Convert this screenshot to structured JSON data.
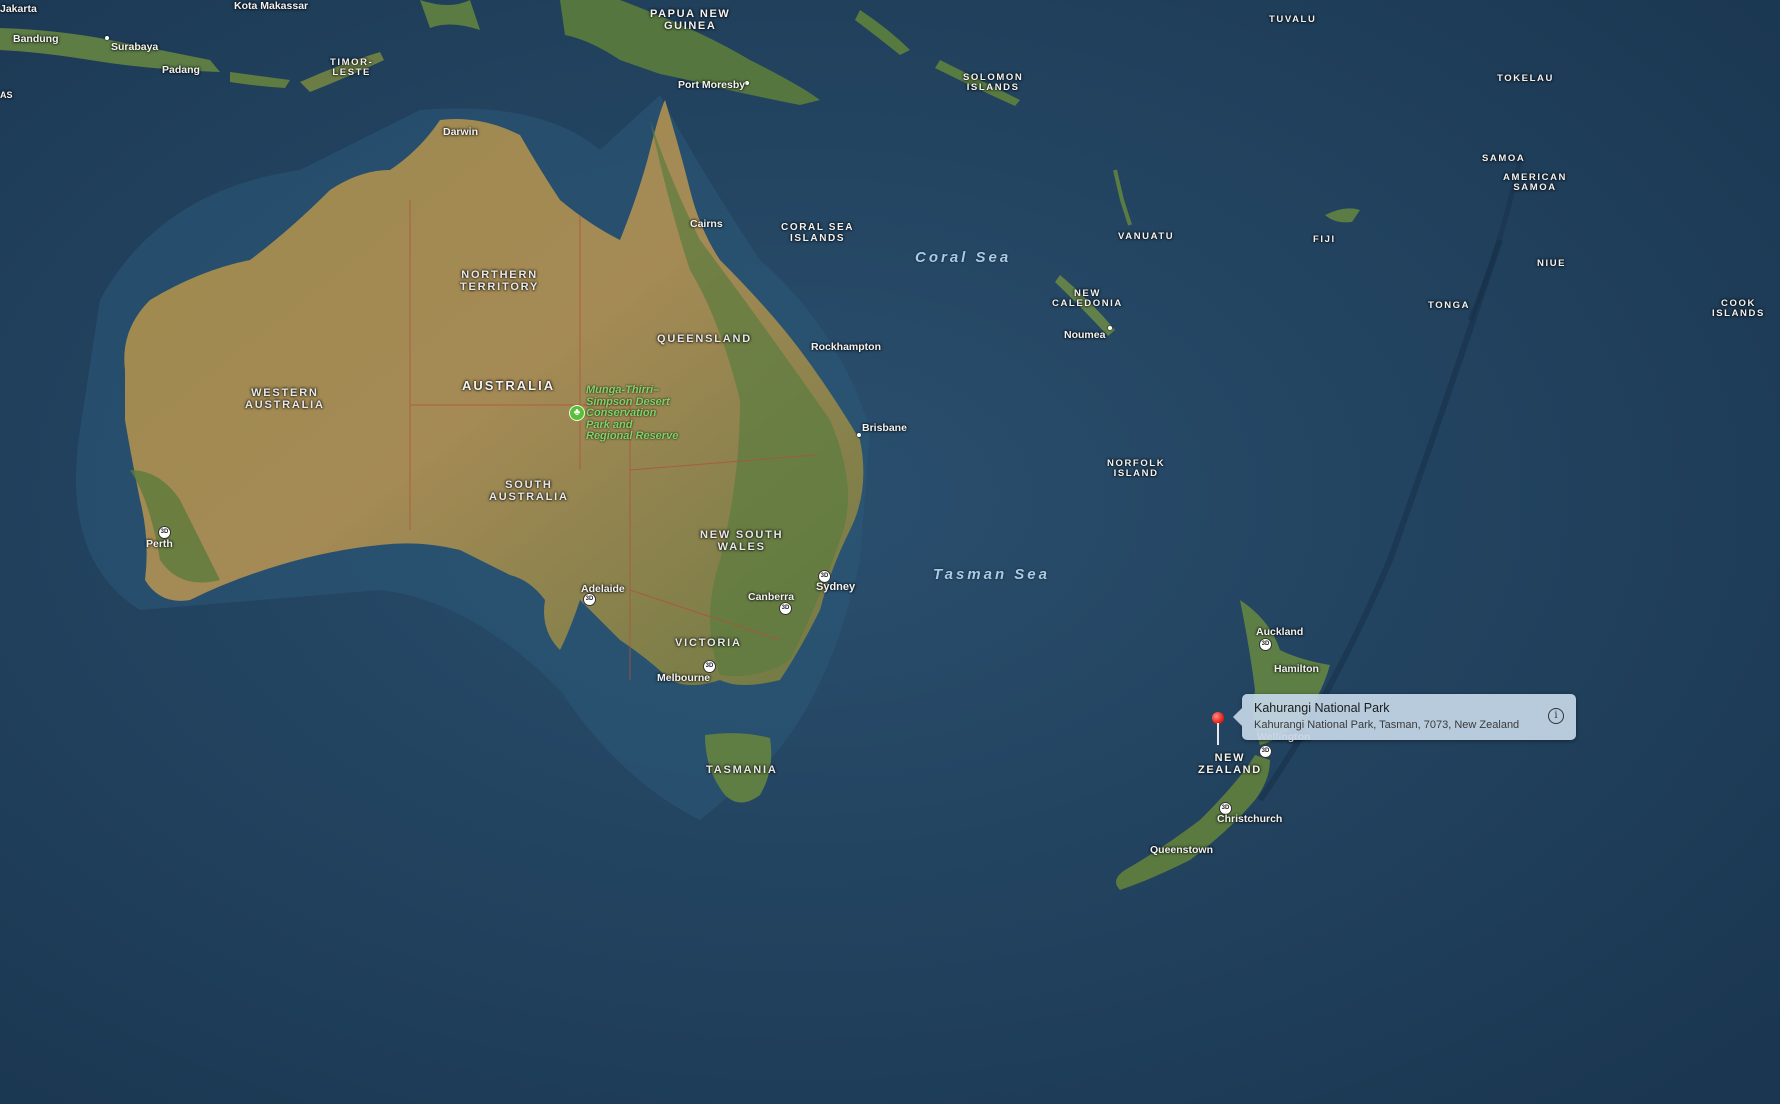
{
  "seas": {
    "coral": "Coral Sea",
    "tasman": "Tasman Sea"
  },
  "countries": {
    "png": "PAPUA NEW\nGUINEA",
    "timor": "TIMOR-\nLESTE",
    "solomon": "SOLOMON\nISLANDS",
    "tuvalu": "TUVALU",
    "tokelau": "TOKELAU",
    "samoa": "SAMOA",
    "american_samoa": "AMERICAN\nSAMOA",
    "coral_islands": "CORAL SEA\nISLANDS",
    "vanuatu": "VANUATU",
    "fiji": "FIJI",
    "niue": "NIUE",
    "cook": "COOK\nISLANDS",
    "tonga": "TONGA",
    "new_caledonia": "NEW\nCALEDONIA",
    "norfolk": "NORFOLK\nISLAND",
    "australia": "AUSTRALIA",
    "new_zealand": "NEW\nZEALAND"
  },
  "regions": {
    "northern_territory": "NORTHERN\nTERRITORY",
    "queensland": "QUEENSLAND",
    "western_australia": "WESTERN\nAUSTRALIA",
    "south_australia": "SOUTH\nAUSTRALIA",
    "nsw": "NEW SOUTH\nWALES",
    "victoria": "VICTORIA",
    "tasmania": "TASMANIA"
  },
  "cities": {
    "jakarta": "Jakarta",
    "kota_makassar": "Kota Makassar",
    "bandung": "Bandung",
    "surabaya": "Surabaya",
    "padang": "Padang",
    "port_moresby": "Port Moresby",
    "darwin": "Darwin",
    "cairns": "Cairns",
    "rockhampton": "Rockhampton",
    "brisbane": "Brisbane",
    "noumea": "Noumea",
    "perth": "Perth",
    "adelaide": "Adelaide",
    "canberra": "Canberra",
    "sydney": "Sydney",
    "melbourne": "Melbourne",
    "auckland": "Auckland",
    "hamilton": "Hamilton",
    "wellington": "Wellington",
    "christchurch": "Christchurch",
    "queenstown": "Queenstown",
    "as_partial": "AS"
  },
  "park_label": "Munga-Thirri–\nSimpson Desert\nConservation\nPark and\nRegional Reserve",
  "shield_text": "3D",
  "callout": {
    "title": "Kahurangi National Park",
    "subtitle": "Kahurangi National Park, Tasman, 7073, New Zealand",
    "info_icon": "i"
  },
  "colors": {
    "ocean": "#1f3d5a",
    "land_arid": "#9a8a4e",
    "land_green": "#4f7a3a",
    "pin_red": "#e5251b",
    "callout_bg": "#c4d7e8"
  }
}
